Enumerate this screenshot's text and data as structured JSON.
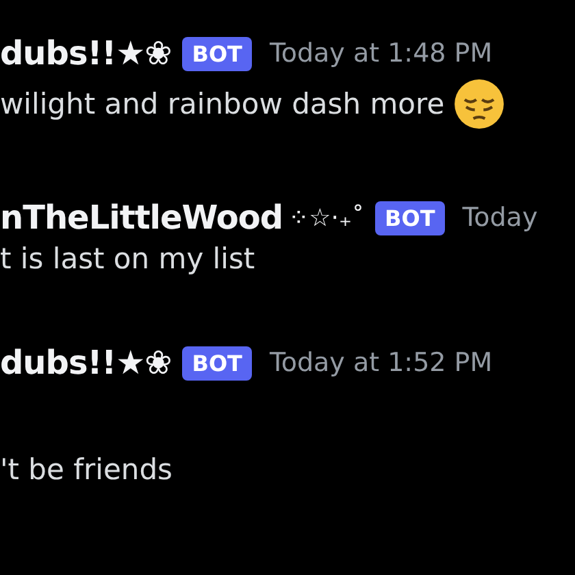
{
  "messages": [
    {
      "username": "dubs!!★❀",
      "badge": "BOT",
      "timestamp": "Today at 1:48 PM",
      "text": "wilight and rainbow dash more",
      "emoji": true,
      "gap_before_text": false
    },
    {
      "username": "nTheLittleWood",
      "decoration": "⁘☆·₊˚",
      "badge": "BOT",
      "timestamp": "Today",
      "text": "t is last on my list",
      "emoji": false,
      "gap_before_text": false
    },
    {
      "username": "dubs!!★❀",
      "badge": "BOT",
      "timestamp": "Today at 1:52 PM",
      "text": "'t be friends",
      "emoji": false,
      "gap_before_text": true
    }
  ]
}
